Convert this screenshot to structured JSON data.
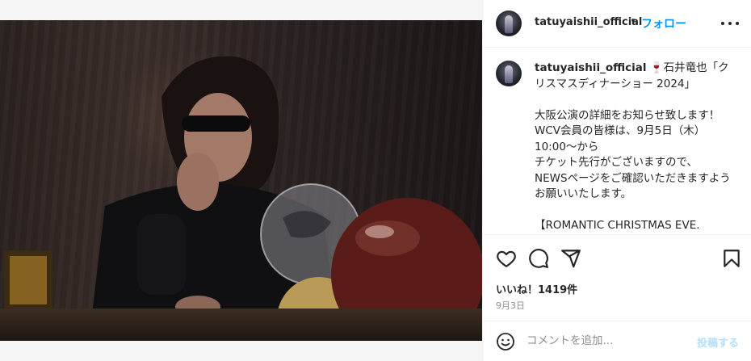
{
  "post": {
    "username": "tatuyaishii_official",
    "follow_label": "フォロー",
    "dot": "•",
    "caption": {
      "username": "tatuyaishii_official",
      "text": "🍷石井竜也「クリスマスディナーショー 2024」\n\n大阪公演の詳細をお知らせ致します！\nWCV会員の皆様は、9月5日（木）10:00〜から\nチケット先行がございますので、\nNEWSページをご確認いただきますようお願いいたします。\n\n【ROMANTIC CHRISTMAS EVE.\nTATUYA ISHII SEXY VOICE SHOW TIME"
    },
    "likes": "いいね！1419件",
    "date": "9月3日",
    "comment": {
      "placeholder": "コメントを追加...",
      "post_label": "投稿する"
    }
  },
  "icons": {
    "more": "more-icon",
    "like": "heart-icon",
    "comment": "comment-icon",
    "share": "paper-plane-icon",
    "save": "bookmark-icon",
    "emoji": "smiley-icon"
  },
  "colors": {
    "accent": "#0095f6",
    "post_disabled": "#b2dffc",
    "muted": "#8e8e8e"
  }
}
